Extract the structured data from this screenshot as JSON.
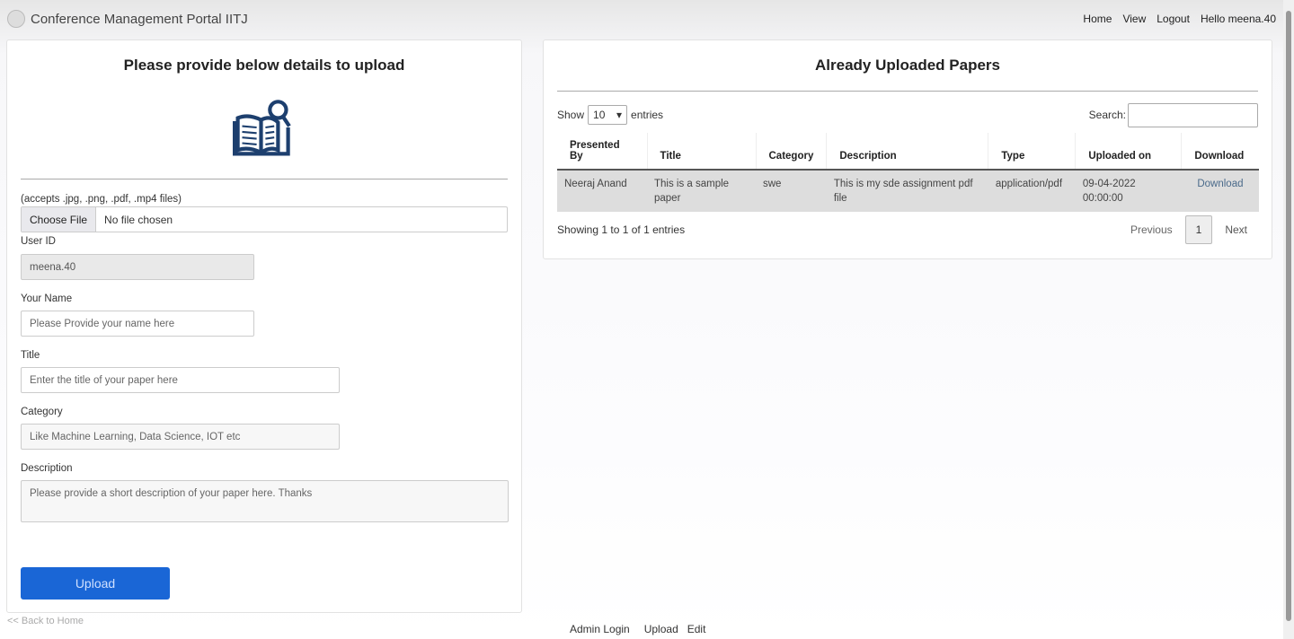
{
  "nav": {
    "brand": "Conference Management Portal IITJ",
    "links": [
      "Home",
      "View",
      "Logout"
    ],
    "greeting": "Hello meena.40"
  },
  "form": {
    "heading": "Please provide below details to upload",
    "accepts": "(accepts .jpg, .png, .pdf, .mp4 files)",
    "choose_file": "Choose File",
    "no_file": "No file chosen",
    "user_id_label": "User ID",
    "user_id_value": "meena.40",
    "name_label": "Your Name",
    "name_placeholder": "Please Provide your name here",
    "title_label": "Title",
    "title_placeholder": "Enter the title of your paper here",
    "category_label": "Category",
    "category_placeholder": "Like Machine Learning, Data Science, IOT etc",
    "description_label": "Description",
    "description_placeholder": "Please provide a short description of your paper here. Thanks",
    "upload": "Upload",
    "back": "<< Back to Home"
  },
  "papers": {
    "heading": "Already Uploaded Papers",
    "show": "Show",
    "entries_value": "10",
    "entries": "entries",
    "search": "Search:",
    "columns": [
      "Presented By",
      "Title",
      "Category",
      "Description",
      "Type",
      "Uploaded on",
      "Download"
    ],
    "rows": [
      [
        "Neeraj Anand",
        "This is a sample paper",
        "swe",
        "This is my sde assignment pdf file",
        "application/pdf",
        "09-04-2022 00:00:00",
        "Download"
      ]
    ],
    "info": "Showing 1 to 1 of 1 entries",
    "previous": "Previous",
    "page": "1",
    "next": "Next"
  },
  "footer": {
    "links": [
      "Admin Login",
      "Upload",
      "Edit"
    ]
  },
  "colors": {
    "primary": "#1a66d6",
    "icon": "#1d3f6e"
  }
}
